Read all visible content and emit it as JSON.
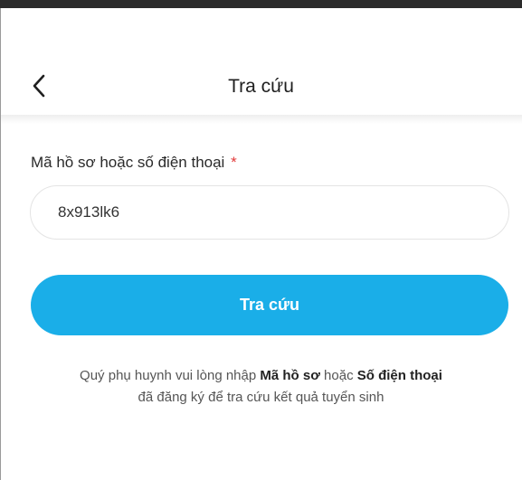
{
  "header": {
    "back_icon": "chevron-left-icon",
    "title": "Tra cứu"
  },
  "form": {
    "label": "Mã hồ sơ hoặc số điện thoại",
    "required_mark": "*",
    "input_value": "8x913lk6",
    "submit_label": "Tra cứu"
  },
  "help": {
    "part1": "Quý phụ huynh vui lòng nhập ",
    "bold1": "Mã hồ sơ",
    "part2": " hoặc ",
    "bold2": "Số điện thoại",
    "line2": "đã đăng ký để tra cứu kết quả tuyển sinh"
  },
  "colors": {
    "accent": "#1aaee8",
    "required": "#e23b3b"
  }
}
